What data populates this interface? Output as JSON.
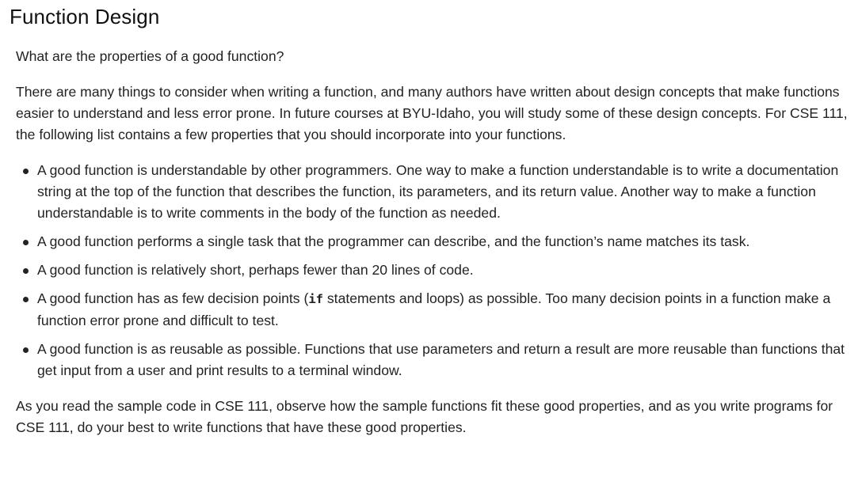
{
  "title": "Function Design",
  "question": "What are the properties of a good function?",
  "intro": "There are many things to consider when writing a function, and many authors have written about design concepts that make functions easier to understand and less error prone. In future courses at BYU-Idaho, you will study some of these design concepts. For CSE 111, the following list contains a few properties that you should incorporate into your functions.",
  "bullets": [
    {
      "text": "A good function is understandable by other programmers. One way to make a function understandable is to write a documentation string at the top of the function that describes the function, its parameters, and its return value. Another way to make a function understandable is to write comments in the body of the function as needed."
    },
    {
      "text": "A good function performs a single task that the programmer can describe, and the function’s name matches its task."
    },
    {
      "text": "A good function is relatively short, perhaps fewer than 20 lines of code."
    },
    {
      "before": "A good function has as few decision points (",
      "code": "if",
      "after": " statements and loops) as possible. Too many decision points in a function make a function error prone and difficult to test."
    },
    {
      "text": "A good function is as reusable as possible. Functions that use parameters and return a result are more reusable than functions that get input from a user and print results to a terminal window."
    }
  ],
  "conclusion": "As you read the sample code in CSE 111, observe how the sample functions fit these good properties, and as you write programs for CSE 111, do your best to write functions that have these good properties."
}
